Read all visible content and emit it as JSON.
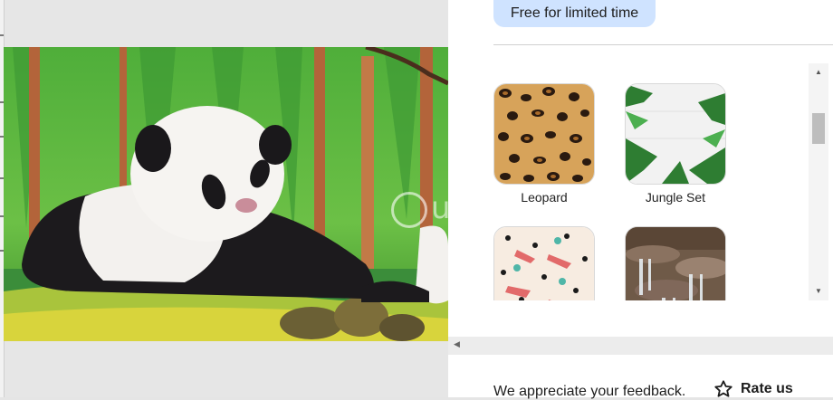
{
  "promo": {
    "label": "Free for limited time"
  },
  "tiles": [
    {
      "label": "Leopard"
    },
    {
      "label": "Jungle Set"
    },
    {
      "label": ""
    },
    {
      "label": ""
    }
  ],
  "footer": {
    "feedback_text": "We appreciate your feedback.",
    "rate_label": "Rate us"
  },
  "watermark": "uantrimang",
  "colors": {
    "promo_bg": "#cfe3ff",
    "jungle_green": "#5fb53a",
    "scrollbar_thumb": "#bdbdbd"
  },
  "icons": [
    "star-icon",
    "scroll-up-arrow-icon",
    "scroll-down-arrow-icon",
    "scroll-left-arrow-icon"
  ]
}
